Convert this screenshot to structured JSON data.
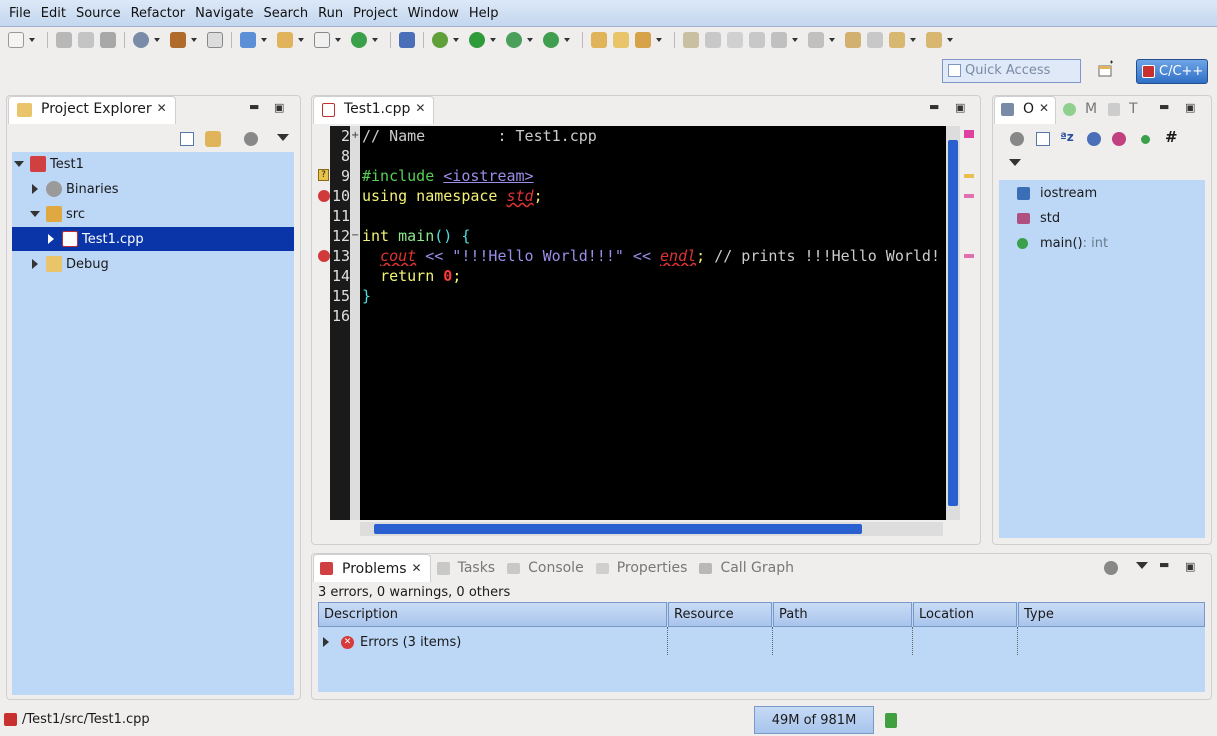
{
  "menu": [
    {
      "label": "File"
    },
    {
      "label": "Edit"
    },
    {
      "label": "Source"
    },
    {
      "label": "Refactor"
    },
    {
      "label": "Navigate"
    },
    {
      "label": "Search"
    },
    {
      "label": "Run"
    },
    {
      "label": "Project"
    },
    {
      "label": "Window"
    },
    {
      "label": "Help"
    }
  ],
  "quick_access": {
    "placeholder": "Quick Access"
  },
  "perspective": {
    "label": "C/C++"
  },
  "project_explorer": {
    "tab_label": "Project Explorer",
    "items": [
      {
        "label": "Test1",
        "level": 0,
        "expanded": true
      },
      {
        "label": "Binaries",
        "level": 1,
        "expanded": false
      },
      {
        "label": "src",
        "level": 1,
        "expanded": true
      },
      {
        "label": "Test1.cpp",
        "level": 2,
        "expanded": false,
        "selected": true
      },
      {
        "label": "Debug",
        "level": 1,
        "expanded": false
      }
    ]
  },
  "editor": {
    "tab_label": "Test1.cpp",
    "line_numbers": [
      "2",
      "8",
      "9",
      "10",
      "11",
      "12",
      "13",
      "14",
      "15",
      "16"
    ],
    "lines": [
      "// Name        : Test1.cpp",
      "",
      "#include <iostream>",
      "using namespace std;",
      "",
      "int main() {",
      "  cout << \"!!!Hello World!!!\" << endl; // prints !!!Hello World!!!",
      "  return 0;",
      "}",
      ""
    ]
  },
  "outline": {
    "tabs": [
      {
        "label": "O"
      },
      {
        "label": "M"
      },
      {
        "label": "T"
      }
    ],
    "items": [
      {
        "label": "iostream",
        "suffix": ""
      },
      {
        "label": "std",
        "suffix": ""
      },
      {
        "label": "main()",
        "suffix": " : int"
      }
    ]
  },
  "bottom_tabs": [
    {
      "label": "Problems",
      "active": true
    },
    {
      "label": "Tasks"
    },
    {
      "label": "Console"
    },
    {
      "label": "Properties"
    },
    {
      "label": "Call Graph"
    }
  ],
  "problems": {
    "summary": "3 errors, 0 warnings, 0 others",
    "columns": [
      "Description",
      "Resource",
      "Path",
      "Location",
      "Type"
    ],
    "rows": [
      {
        "description": "Errors (3 items)"
      }
    ]
  },
  "status": {
    "path": "/Test1/src/Test1.cpp",
    "heap": "49M of 981M"
  }
}
